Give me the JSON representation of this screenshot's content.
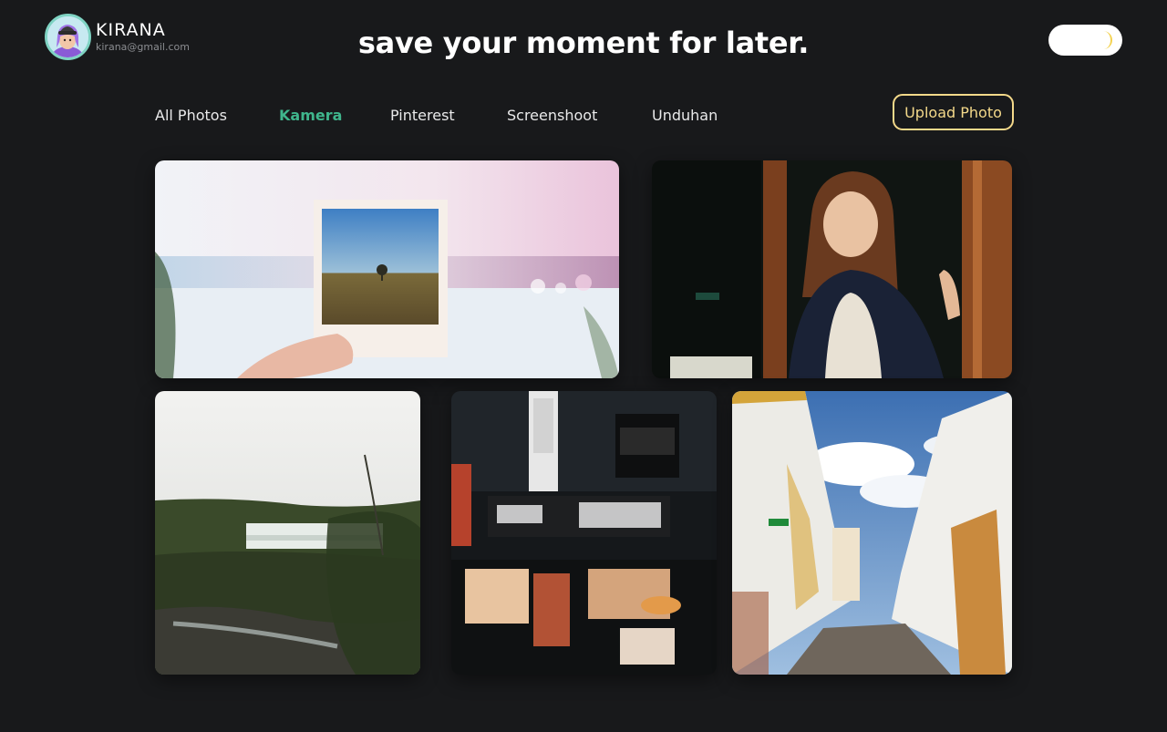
{
  "profile": {
    "name": "KIRANA",
    "email": "kirana@gmail.com"
  },
  "header": {
    "tagline": "save your moment for later."
  },
  "theme_toggle": {
    "icon": "moon-icon",
    "accent_color": "#f4d24e"
  },
  "tabs": [
    {
      "label": "All Photos",
      "active": false
    },
    {
      "label": "Kamera",
      "active": true
    },
    {
      "label": "Pinterest",
      "active": false
    },
    {
      "label": "Screenshoot",
      "active": false
    },
    {
      "label": "Unduhan",
      "active": false
    }
  ],
  "upload": {
    "label": "Upload Photo",
    "color": "#f4d98a"
  },
  "colors": {
    "background": "#18191b",
    "active_tab": "#3fb58c",
    "avatar_border": "#7fd3c3"
  },
  "photos": [
    {
      "subject": "polaroid-photo"
    },
    {
      "subject": "woman-at-shop-door"
    },
    {
      "subject": "waterfall-landscape"
    },
    {
      "subject": "night-street-storefront"
    },
    {
      "subject": "white-town-alley"
    }
  ]
}
